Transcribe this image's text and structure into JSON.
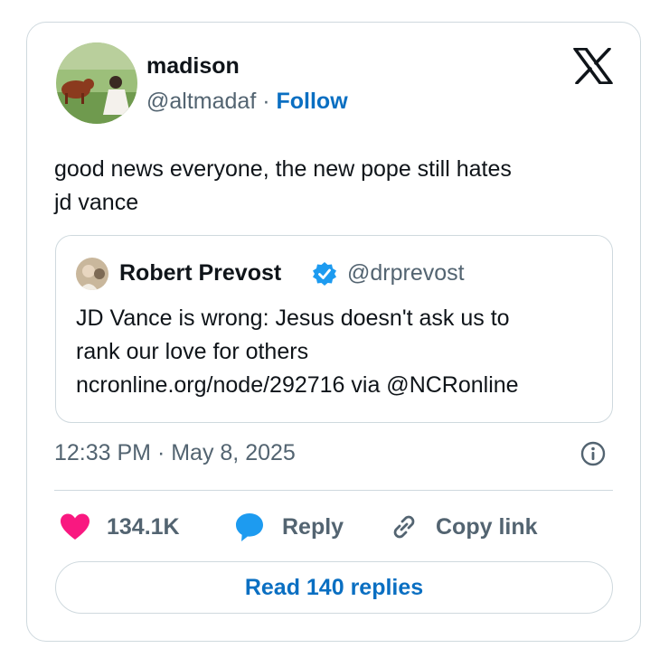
{
  "tweet": {
    "author": {
      "name": "madison",
      "handle": "@altmadaf",
      "separator": "·",
      "follow_label": "Follow"
    },
    "text_line1": "good news everyone, the new pope still hates",
    "text_line2": "jd vance",
    "quoted": {
      "name": "Robert Prevost",
      "handle": "@drprevost",
      "verified": true,
      "text_line1": "JD Vance is wrong: Jesus doesn't ask us to",
      "text_line2": "rank our love for others",
      "text_line3": "ncronline.org/node/292716 via @NCRonline"
    },
    "timestamp": "12:33 PM · May 8, 2025",
    "actions": {
      "like_count": "134.1K",
      "reply_label": "Reply",
      "copy_label": "Copy link"
    },
    "read_replies_label": "Read 140 replies"
  },
  "icons": [
    "x-logo-icon",
    "verified-badge-icon",
    "info-icon",
    "heart-icon",
    "reply-bubble-icon",
    "link-icon"
  ],
  "colors": {
    "link_blue": "#0a6fc2",
    "heart_pink": "#f91880",
    "reply_blue": "#1d9bf0",
    "verified_blue": "#1d9bf0",
    "muted_text": "#536471",
    "border": "#cfd9de"
  }
}
